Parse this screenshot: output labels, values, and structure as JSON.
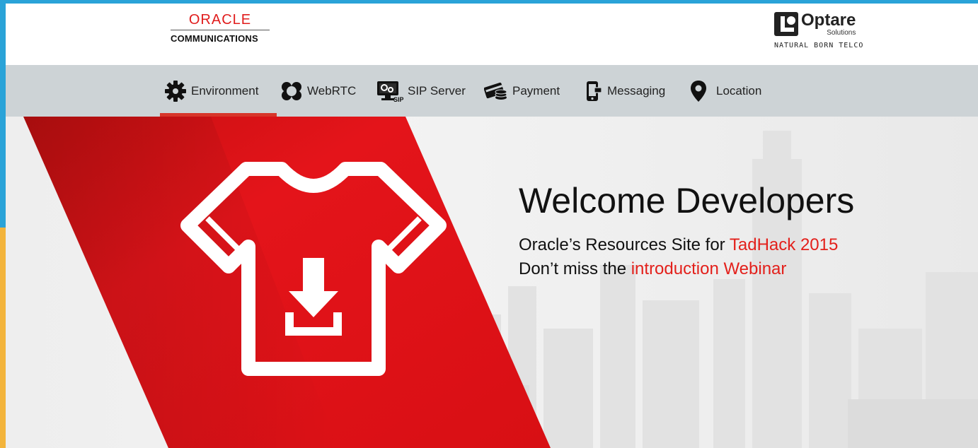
{
  "header": {
    "oracle_logo": {
      "word": "ORACLE",
      "sub": "COMMUNICATIONS"
    },
    "optare_logo": {
      "name": "Optare",
      "sub": "Solutions",
      "tagline": "NATURAL BORN TELCO"
    }
  },
  "nav": {
    "active": "Environment",
    "items": [
      {
        "label": "Environment",
        "icon": "gear-icon"
      },
      {
        "label": "WebRTC",
        "icon": "webrtc-icon"
      },
      {
        "label": "SIP Server",
        "icon": "sip-server-icon"
      },
      {
        "label": "Payment",
        "icon": "payment-icon"
      },
      {
        "label": "Messaging",
        "icon": "mobile-icon"
      },
      {
        "label": "Location",
        "icon": "map-pin-icon"
      }
    ]
  },
  "hero": {
    "title": "Welcome Developers",
    "line1_prefix": "Oracle’s Resources Site for ",
    "line1_link": "TadHack 2015",
    "line2_prefix": "Don’t miss the ",
    "line2_link": "introduction Webinar",
    "icon": "tshirt-download-icon"
  },
  "colors": {
    "brand_red": "#e3201b",
    "nav_bg": "#cdd3d6",
    "active_underline": "#d7352a",
    "frame_blue": "#2aa3d8",
    "frame_yellow": "#f3b43c"
  }
}
